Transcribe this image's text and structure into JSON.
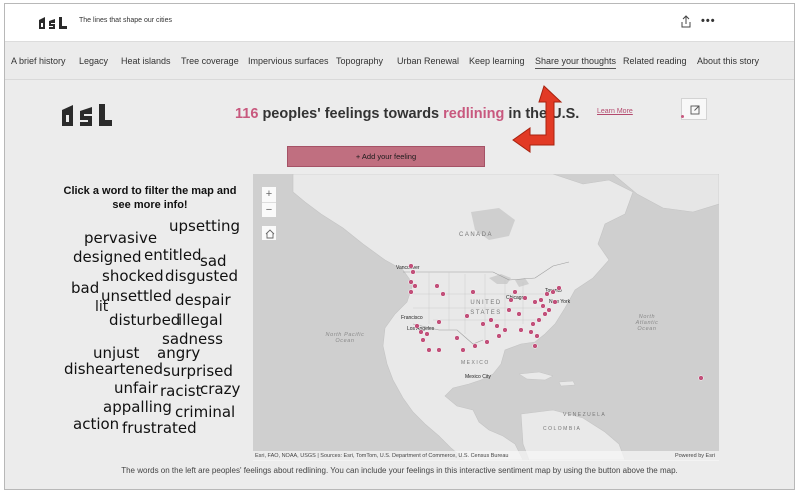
{
  "topbar": {
    "site_title": "The lines that shape our cities"
  },
  "nav": {
    "items": [
      {
        "label": "A brief history"
      },
      {
        "label": "Legacy"
      },
      {
        "label": "Heat islands"
      },
      {
        "label": "Tree coverage"
      },
      {
        "label": "Impervious surfaces"
      },
      {
        "label": "Topography"
      },
      {
        "label": "Urban Renewal"
      },
      {
        "label": "Keep learning"
      },
      {
        "label": "Share your thoughts"
      },
      {
        "label": "Related reading"
      },
      {
        "label": "About this story"
      }
    ],
    "active": "Share your thoughts"
  },
  "header": {
    "count": "116",
    "text_before": "peoples' feelings towards",
    "highlight": "redlining",
    "text_after": "in the U.S.",
    "learn_more": "Learn More"
  },
  "add_button": {
    "label": "+ Add your feeling"
  },
  "filter_instructions": "Click a word to filter the map and see more info!",
  "words": [
    {
      "text": "upsetting"
    },
    {
      "text": "pervasive"
    },
    {
      "text": "designed"
    },
    {
      "text": "entitled"
    },
    {
      "text": "sad"
    },
    {
      "text": "shocked"
    },
    {
      "text": "disgusted"
    },
    {
      "text": "bad"
    },
    {
      "text": "unsettled"
    },
    {
      "text": "despair"
    },
    {
      "text": "lit"
    },
    {
      "text": "disturbed"
    },
    {
      "text": "illegal"
    },
    {
      "text": "sadness"
    },
    {
      "text": "unjust"
    },
    {
      "text": "angry"
    },
    {
      "text": "disheartened"
    },
    {
      "text": "surprised"
    },
    {
      "text": "unfair"
    },
    {
      "text": "racist"
    },
    {
      "text": "crazy"
    },
    {
      "text": "appalling"
    },
    {
      "text": "criminal"
    },
    {
      "text": "action"
    },
    {
      "text": "frustrated"
    }
  ],
  "map": {
    "labels": {
      "canada": "CANADA",
      "united_states": "UNITED STATES",
      "mexico": "MEXICO",
      "venezuela": "VENEZUELA",
      "colombia": "COLOMBIA",
      "north_pacific": "North Pacific Ocean",
      "north_atlantic": "North Atlantic Ocean"
    },
    "cities": {
      "vancouver": "Vancouver",
      "chicago": "Chicago",
      "toronto": "Toronto",
      "new_york": "New York",
      "francisco": "Francisco",
      "los_angeles": "Los Angeles",
      "mexico_city": "Mexico City"
    },
    "attribution": "Esri, FAO, NOAA, USGS | Sources: Esri, TomTom, U.S. Department of Commerce, U.S. Census Bureau",
    "powered_by": "Powered by Esri",
    "marker_color": "#c2507a"
  },
  "caption": "The words on the left are peoples' feelings about redlining. You can include your feelings in this interactive sentiment map by using the button above the map.",
  "colors": {
    "accent": "#c8587e",
    "button": "#c06f80",
    "arrow": "#e23a25"
  }
}
